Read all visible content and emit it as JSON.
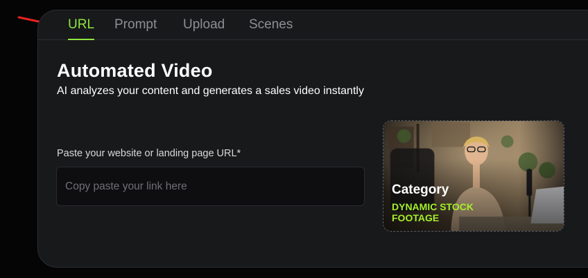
{
  "tabs": [
    {
      "label": "URL",
      "active": true
    },
    {
      "label": "Prompt",
      "active": false
    },
    {
      "label": "Upload",
      "active": false
    },
    {
      "label": "Scenes",
      "active": false
    }
  ],
  "main": {
    "title": "Automated Video",
    "subtitle": "AI analyzes your content and generates a sales video instantly"
  },
  "url_field": {
    "label": "Paste your website or landing page URL*",
    "placeholder": "Copy paste your link here",
    "value": ""
  },
  "category_card": {
    "heading": "Category",
    "name": "DYNAMIC STOCK FOOTAGE"
  },
  "colors": {
    "accent": "#8ee53f",
    "card_highlight": "#a5f02a",
    "arrow": "#e8231f",
    "panel_bg": "#18191b"
  },
  "icons": {
    "arrow": "red-arrow-icon"
  }
}
